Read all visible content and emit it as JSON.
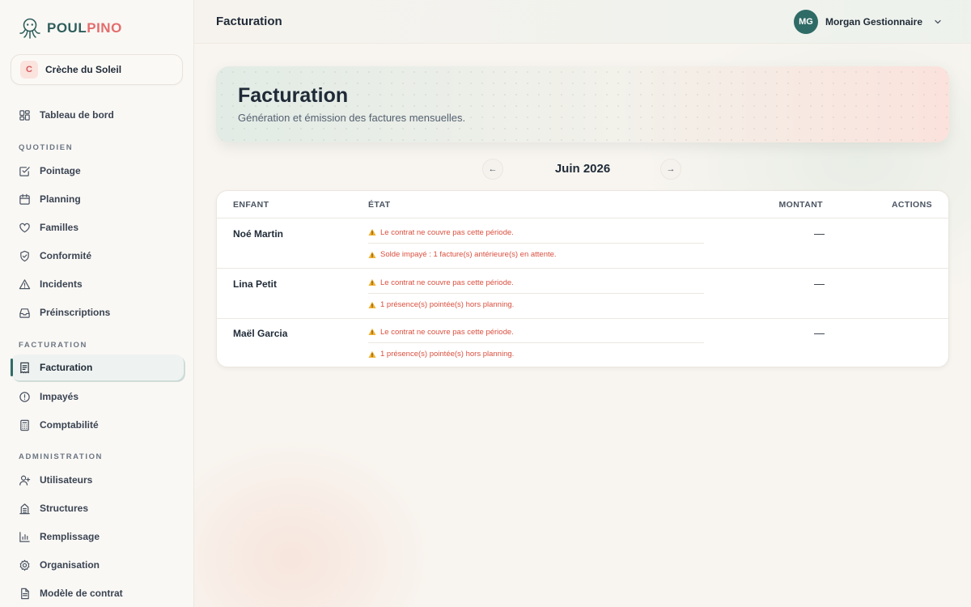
{
  "app": {
    "logo_part1": "POUL",
    "logo_part2": "PINO"
  },
  "colors": {
    "primary": "#2f6b66",
    "accent": "#e36d6d",
    "warning": "#d9503f"
  },
  "org": {
    "initial": "C",
    "name": "Crèche du Soleil"
  },
  "sidebar": {
    "top_item": {
      "label": "Tableau de bord",
      "icon": "dashboard-icon"
    },
    "sections": [
      {
        "title": "QUOTIDIEN",
        "items": [
          {
            "label": "Pointage",
            "icon": "checkbox-icon"
          },
          {
            "label": "Planning",
            "icon": "calendar-icon"
          },
          {
            "label": "Familles",
            "icon": "heart-icon"
          },
          {
            "label": "Conformité",
            "icon": "shield-check-icon"
          },
          {
            "label": "Incidents",
            "icon": "alert-triangle-icon"
          },
          {
            "label": "Préinscriptions",
            "icon": "inbox-icon"
          }
        ]
      },
      {
        "title": "FACTURATION",
        "items": [
          {
            "label": "Facturation",
            "icon": "receipt-icon",
            "active": true
          },
          {
            "label": "Impayés",
            "icon": "alert-circle-icon"
          },
          {
            "label": "Comptabilité",
            "icon": "calculator-icon"
          }
        ]
      },
      {
        "title": "ADMINISTRATION",
        "items": [
          {
            "label": "Utilisateurs",
            "icon": "user-plus-icon"
          },
          {
            "label": "Structures",
            "icon": "building-icon"
          },
          {
            "label": "Remplissage",
            "icon": "bar-chart-icon"
          },
          {
            "label": "Organisation",
            "icon": "settings-icon"
          },
          {
            "label": "Modèle de contrat",
            "icon": "document-icon"
          }
        ]
      }
    ]
  },
  "topbar": {
    "title": "Facturation"
  },
  "user": {
    "initials": "MG",
    "name": "Morgan Gestionnaire"
  },
  "hero": {
    "title": "Facturation",
    "subtitle": "Génération et émission des factures mensuelles."
  },
  "month_nav": {
    "prev": "←",
    "label": "Juin 2026",
    "next": "→"
  },
  "table": {
    "headers": {
      "enfant": "ENFANT",
      "etat": "ÉTAT",
      "montant": "MONTANT",
      "actions": "ACTIONS"
    },
    "rows": [
      {
        "name": "Noé Martin",
        "warnings": [
          "Le contrat ne couvre pas cette période.",
          "Solde impayé : 1 facture(s) antérieure(s) en attente."
        ],
        "amount": "—"
      },
      {
        "name": "Lina Petit",
        "warnings": [
          "Le contrat ne couvre pas cette période.",
          "1 présence(s) pointée(s) hors planning."
        ],
        "amount": "—"
      },
      {
        "name": "Maël Garcia",
        "warnings": [
          "Le contrat ne couvre pas cette période.",
          "1 présence(s) pointée(s) hors planning."
        ],
        "amount": "—"
      }
    ]
  }
}
